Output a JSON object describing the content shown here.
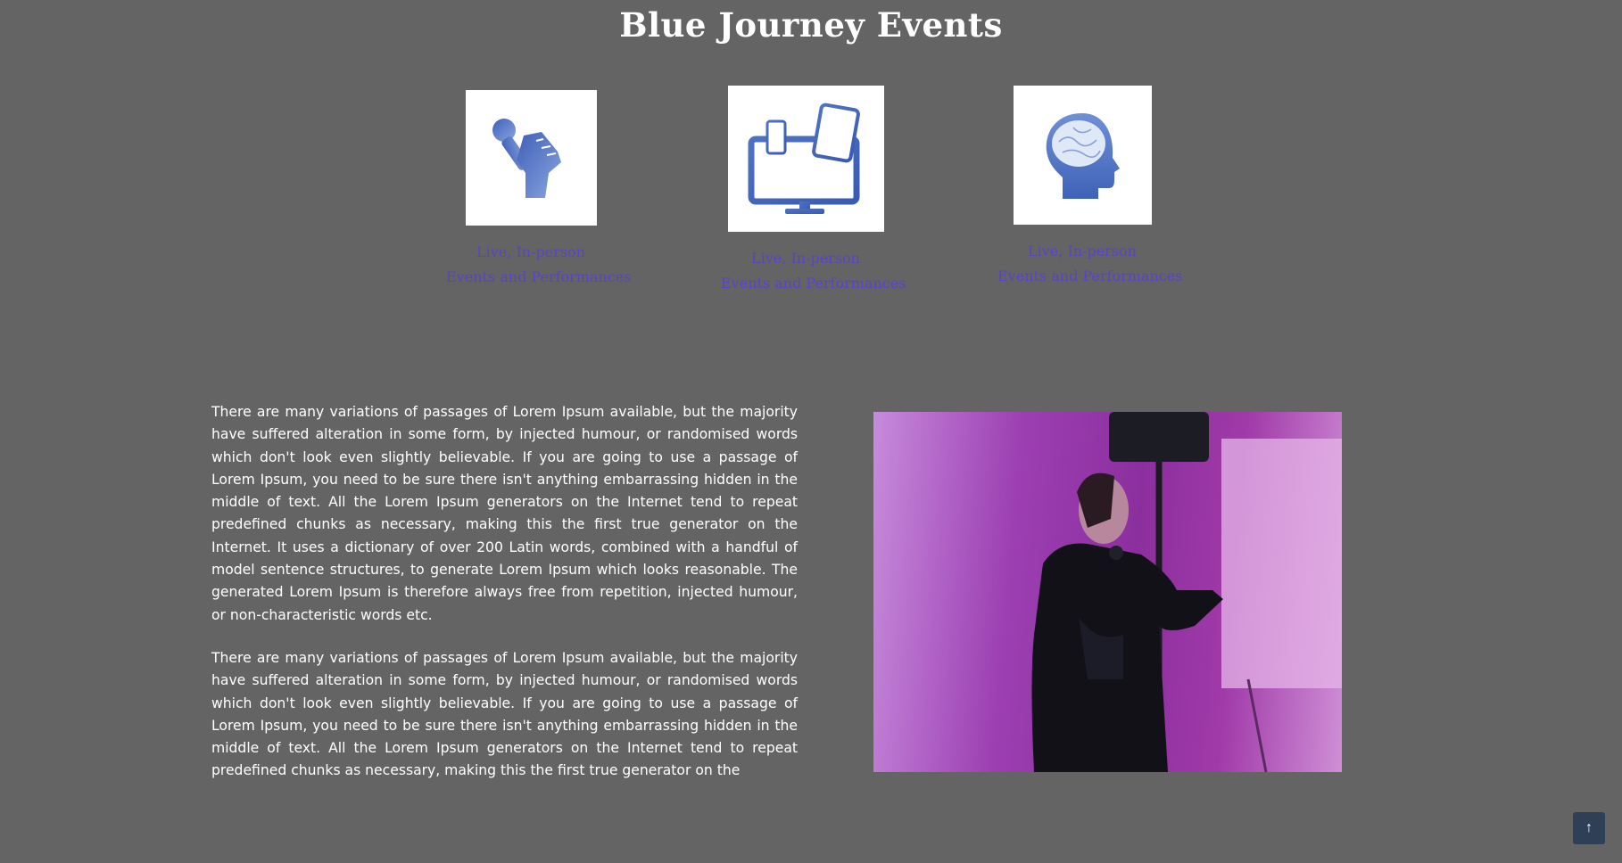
{
  "header": {
    "title": "Blue Journey Events"
  },
  "features": [
    {
      "icon": "microphone-fist-icon",
      "line1": "Live, In-person",
      "line2": "Events and Performances"
    },
    {
      "icon": "devices-icon",
      "line1": "Live, In-person",
      "line2": "Events and Performances"
    },
    {
      "icon": "brain-head-icon",
      "line1": "Live, In-person",
      "line2": "Events and Performances"
    }
  ],
  "content": {
    "paragraph1": "There are many variations of passages of Lorem Ipsum available, but the majority have suffered alteration in some form, by injected humour, or randomised words which don't look even slightly believable. If you are going to use a passage of Lorem Ipsum, you need to be sure there isn't anything embarrassing hidden in the middle of text. All the Lorem Ipsum generators on the Internet tend to repeat predefined chunks as necessary, making this the first true generator on the Internet. It uses a dictionary of over 200 Latin words, combined with a handful of model sentence structures, to generate Lorem Ipsum which looks reasonable. The generated Lorem Ipsum is therefore always free from repetition, injected humour, or non-characteristic words etc.",
    "paragraph2": "There are many variations of passages of Lorem Ipsum available, but the majority have suffered alteration in some form, by injected humour, or randomised words which don't look even slightly believable. If you are going to use a passage of Lorem Ipsum, you need to be sure there isn't anything embarrassing hidden in the middle of text. All the Lorem Ipsum generators on the Internet tend to repeat predefined chunks as necessary, making this the first true generator on the"
  },
  "scroll_top": {
    "icon": "arrow-up-icon",
    "glyph": "↑"
  },
  "colors": {
    "background": "#646464",
    "caption": "#5b43c6",
    "icon_blue": "#4f73c2",
    "scroll_button": "#2f3f56"
  }
}
